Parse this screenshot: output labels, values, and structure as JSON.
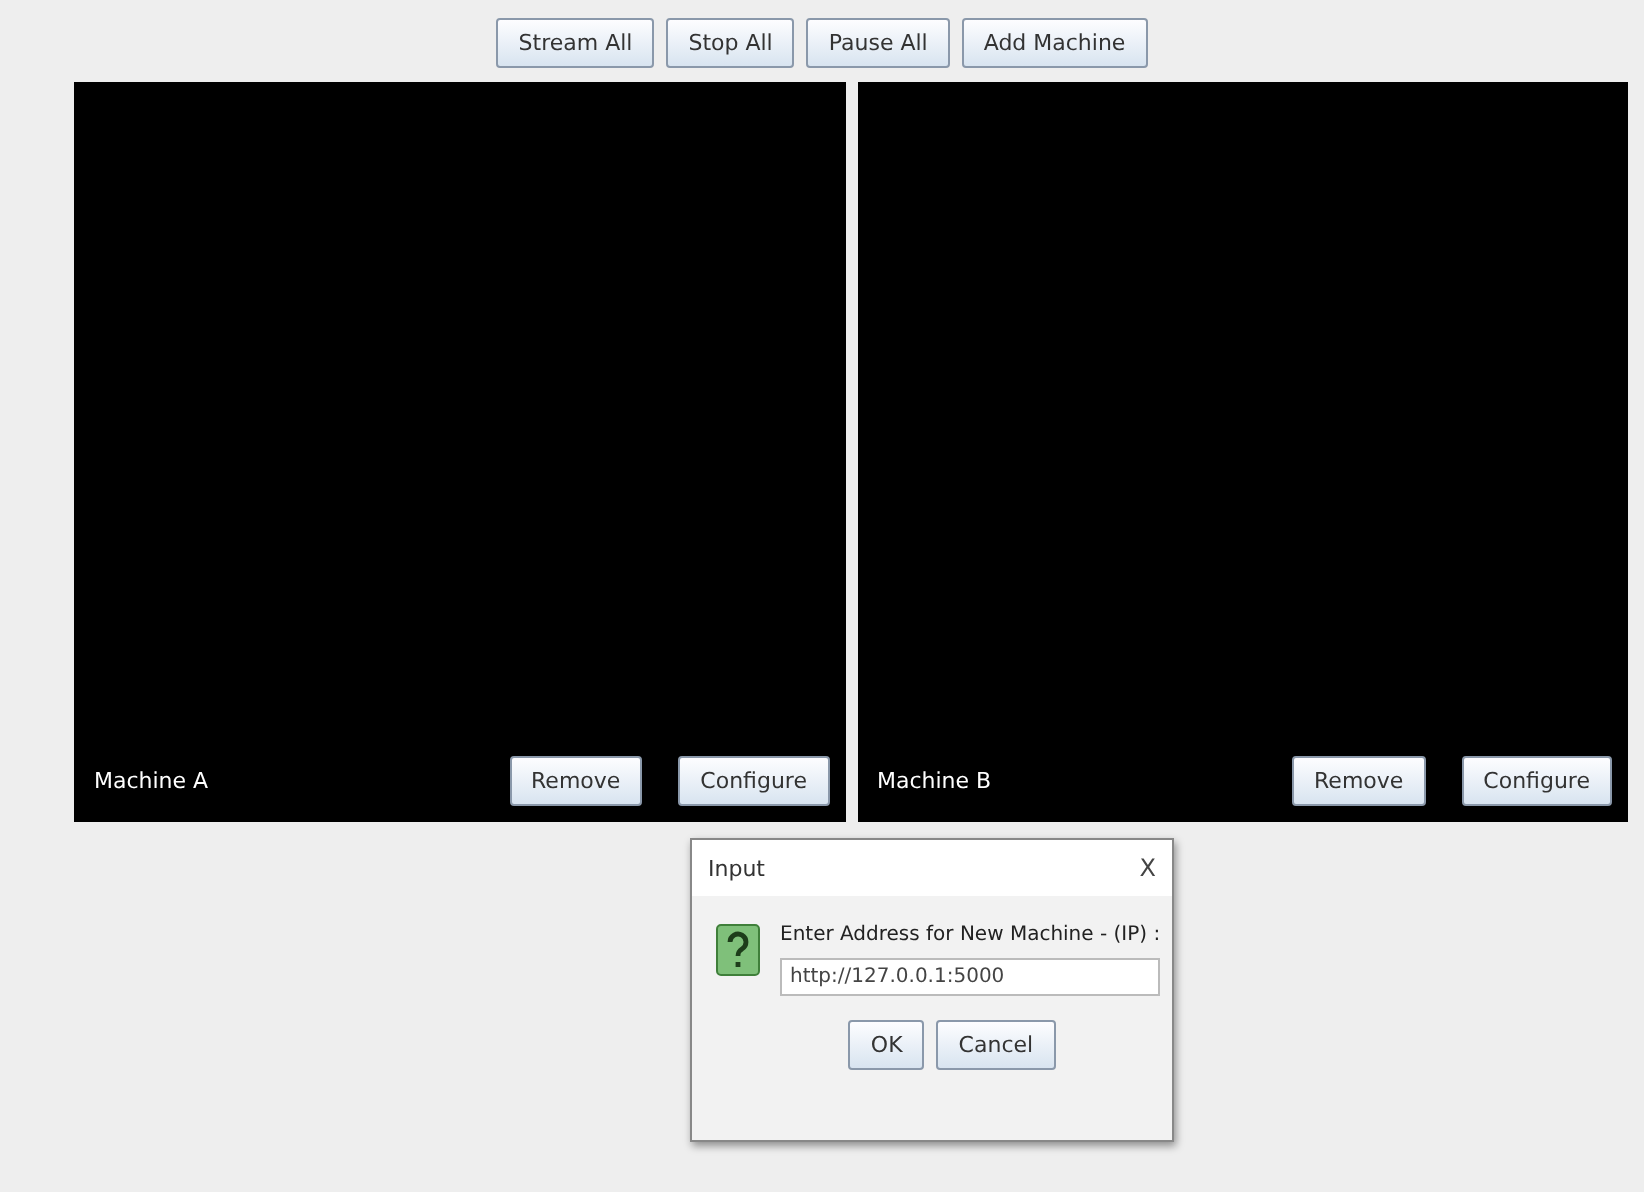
{
  "toolbar": {
    "buttons": [
      "Stream All",
      "Stop All",
      "Pause All",
      "Add Machine"
    ]
  },
  "machines": [
    {
      "name": "Machine A",
      "buttons": [
        "Remove",
        "Configure"
      ]
    },
    {
      "name": "Machine B",
      "buttons": [
        "Remove",
        "Configure"
      ]
    }
  ],
  "dialog": {
    "title": "Input",
    "close": "X",
    "message": "Enter Address for New Machine - (IP) :",
    "value": "http://127.0.0.1:5000",
    "buttons": [
      "OK",
      "Cancel"
    ]
  }
}
